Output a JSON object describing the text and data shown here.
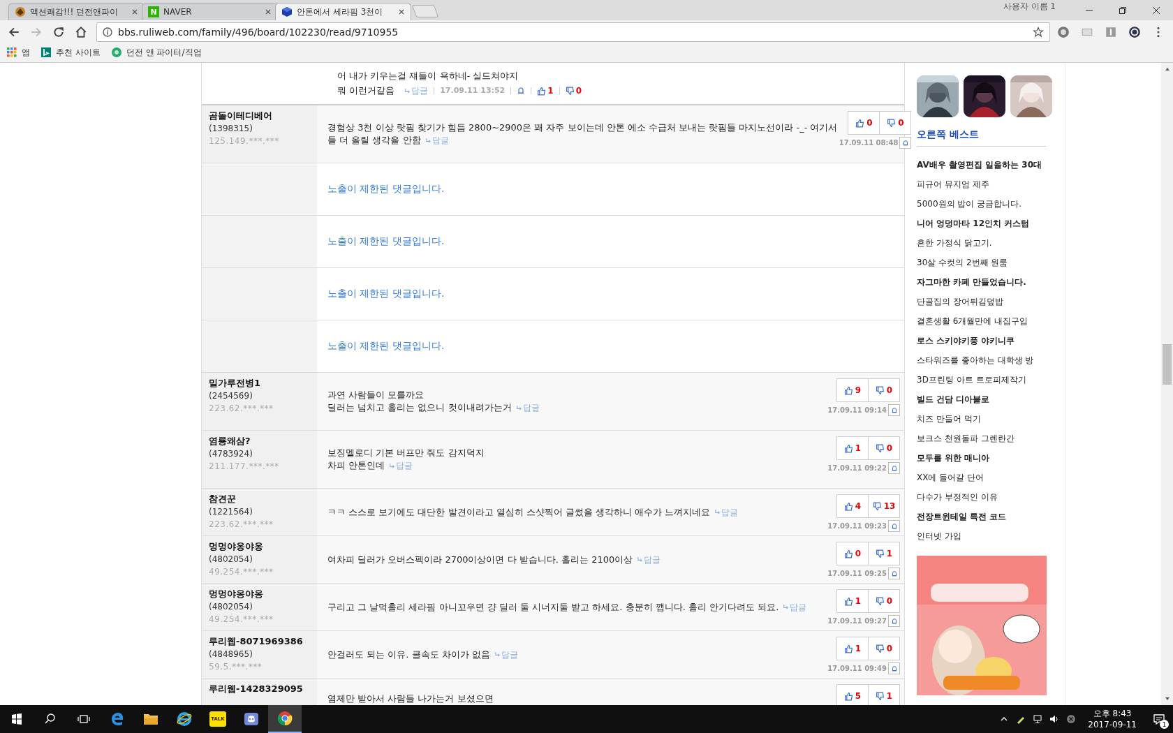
{
  "browser": {
    "tabs": [
      {
        "title": "액션쾌감!!! 던전앤파이",
        "selected": false
      },
      {
        "title": "NAVER",
        "icon_text": "N",
        "selected": false
      },
      {
        "title": "안톤에서 세라핌 3천이",
        "selected": true
      }
    ],
    "user": "사용자 이름 1",
    "url": "bbs.ruliweb.com/family/496/board/102230/read/9710955",
    "bookmarks": [
      {
        "label": "앱"
      },
      {
        "label": "추천 사이트"
      },
      {
        "label": "던전 앤 파이터/직업"
      }
    ]
  },
  "comments": [
    {
      "kind": "reply",
      "lines": [
        "어 내가 키우는걸 쟤들이 욕하네- 실드쳐야지",
        "뭐 이런거같음"
      ],
      "reply": "답글",
      "date": "17.09.11 13:52",
      "up": "1",
      "down": "0"
    },
    {
      "kind": "comment",
      "author": "곰돌이테디베어",
      "member_no": "(1398315)",
      "ip": "125.149.***.***",
      "lines": [
        "경험상 3천 이상 랏핌 찾기가 힘듬 2800~2900은 꽤 자주 보이는데 안톤 에소 수급처 보내는 랏핌들 마지노선이라 -_- 여기서",
        "들 더 올릴 생각을 안함"
      ],
      "reply": "답글",
      "date": "17.09.11 08:48",
      "up": "0",
      "down": "0"
    },
    {
      "kind": "hidden",
      "text": "노출이 제한된 댓글입니다."
    },
    {
      "kind": "hidden",
      "text": "노출이 제한된 댓글입니다."
    },
    {
      "kind": "hidden",
      "text": "노출이 제한된 댓글입니다."
    },
    {
      "kind": "hidden",
      "text": "노출이 제한된 댓글입니다."
    },
    {
      "kind": "comment",
      "author": "밀가루전병1",
      "member_no": "(2454569)",
      "ip": "223.62.***.***",
      "lines": [
        "과연 사람들이 모를까요",
        "딜러는 넘치고 홀리는 없으니 컷이내려가는거"
      ],
      "reply": "답글",
      "date": "17.09.11 09:14",
      "up": "9",
      "down": "0"
    },
    {
      "kind": "comment",
      "author": "염룡왜삼?",
      "member_no": "(4783924)",
      "ip": "211.177.***.***",
      "lines": [
        "보징멜로디 기본 버프만 줘도 감지덕지",
        "차피 안톤인데"
      ],
      "reply": "답글",
      "date": "17.09.11 09:22",
      "up": "1",
      "down": "0"
    },
    {
      "kind": "comment",
      "author": "참견꾼",
      "member_no": "(1221564)",
      "ip": "223.62.***.***",
      "lines": [
        "ㅋㅋ 스스로 보기에도 대단한 발견이라고 열심히 스샷찍어 글썼을 생각하니 애수가 느껴지네요"
      ],
      "reply": "답글",
      "date": "17.09.11 09:23",
      "up": "4",
      "down": "13"
    },
    {
      "kind": "comment",
      "author": "멍멍야옹야옹",
      "member_no": "(4802054)",
      "ip": "49.254.***.***",
      "lines": [
        "여차피 딜러가 오버스펙이라 2700이상이면 다 받습니다. 홀리는 2100이상"
      ],
      "reply": "답글",
      "date": "17.09.11 09:25",
      "up": "0",
      "down": "1"
    },
    {
      "kind": "comment",
      "author": "멍멍야옹야옹",
      "member_no": "(4802054)",
      "ip": "49.254.***.***",
      "lines": [
        "구리고 그 날먹홀리 세라핌 아니꼬우면 걍 딜러 둘 시너지둘 받고 하세요. 충분히 깹니다. 홀리 안기다려도 되요."
      ],
      "reply": "답글",
      "date": "17.09.11 09:27",
      "up": "1",
      "down": "0"
    },
    {
      "kind": "comment",
      "author": "루리웹-8071969386",
      "member_no": "(4848965)",
      "ip": "59.5.***.***",
      "lines": [
        "안걸러도 되는 이유.  클속도 차이가 없음"
      ],
      "reply": "답글",
      "date": "17.09.11 09:49",
      "up": "1",
      "down": "0"
    },
    {
      "kind": "comment",
      "author": "루리웹-1428329095",
      "lines": [
        "염제만 받아서 사람들 나가는거 보셨으면"
      ],
      "up": "5",
      "down": "1"
    }
  ],
  "sidebar": {
    "heading": "오른쪽 베스트",
    "items": [
      {
        "text": "AV배우 촬영편집 일을하는 30대",
        "bold": true
      },
      {
        "text": "피규어 뮤지엄 제주",
        "bold": false
      },
      {
        "text": "5000원의 밥이 궁금합니다.",
        "bold": false
      },
      {
        "text": "니어 엉덩마타 12인치 커스텀",
        "bold": true
      },
      {
        "text": "흔한 가정식 닭고기.",
        "bold": false
      },
      {
        "text": "30살 수컷의 2번째 원룸",
        "bold": false
      },
      {
        "text": "자그마한 카페 만들었습니다.",
        "bold": true
      },
      {
        "text": "단골집의 장어튀김덮밥",
        "bold": false
      },
      {
        "text": "결혼생활 6개월만에 내집구입",
        "bold": false
      },
      {
        "text": "로스 스키야키풍 야키니쿠",
        "bold": true
      },
      {
        "text": "스타워즈를 좋아하는 대학생 방",
        "bold": false
      },
      {
        "text": "3D프린팅 아트 트로피제작기",
        "bold": false
      },
      {
        "text": "빌드 건담 디아블로",
        "bold": true
      },
      {
        "text": "치즈 만들어 먹기",
        "bold": false
      },
      {
        "text": "보크스 천원돌파 그렌란간",
        "bold": false
      },
      {
        "text": "모두를 위한 매니아",
        "bold": true
      },
      {
        "text": "XX에 들어갈 단어",
        "bold": false
      },
      {
        "text": "다수가 부정적인 이유",
        "bold": false
      },
      {
        "text": "전장트윈테일 특전 코드",
        "bold": true
      },
      {
        "text": "인터넷 가입",
        "bold": false
      }
    ]
  },
  "taskbar": {
    "apps": [
      {
        "active": false
      },
      {
        "active": false
      },
      {
        "active": false
      },
      {
        "label": "TALK",
        "active": false
      },
      {
        "active": false
      },
      {
        "active": true
      }
    ],
    "time": "오후 8:43",
    "date": "2017-09-11",
    "notifications": "1"
  }
}
